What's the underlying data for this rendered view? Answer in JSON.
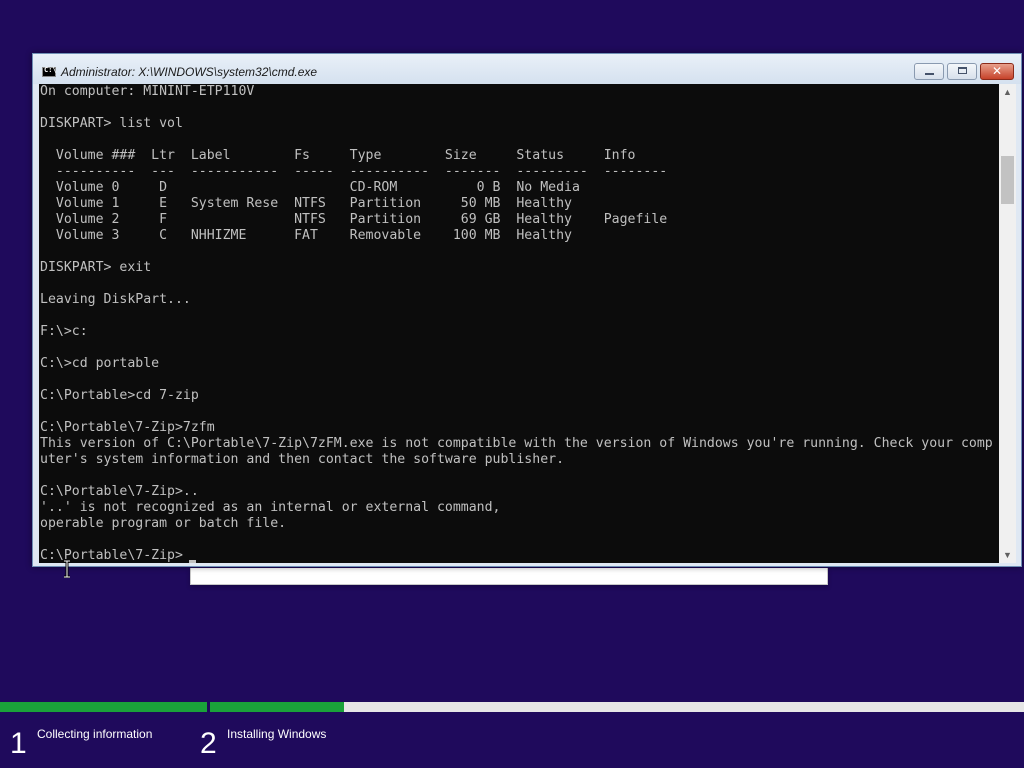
{
  "window": {
    "title": "Administrator: X:\\WINDOWS\\system32\\cmd.exe",
    "icon_text": "C:\\",
    "close_glyph": "✕"
  },
  "console": {
    "lines": [
      "On computer: MININT-ETP110V",
      "",
      "DISKPART> list vol",
      "",
      "  Volume ###  Ltr  Label        Fs     Type        Size     Status     Info",
      "  ----------  ---  -----------  -----  ----------  -------  ---------  --------",
      "  Volume 0     D                       CD-ROM          0 B  No Media",
      "  Volume 1     E   System Rese  NTFS   Partition     50 MB  Healthy",
      "  Volume 2     F                NTFS   Partition     69 GB  Healthy    Pagefile",
      "  Volume 3     C   NHHIZME      FAT    Removable    100 MB  Healthy",
      "",
      "DISKPART> exit",
      "",
      "Leaving DiskPart...",
      "",
      "F:\\>c:",
      "",
      "C:\\>cd portable",
      "",
      "C:\\Portable>cd 7-zip",
      "",
      "C:\\Portable\\7-Zip>7zfm",
      "This version of C:\\Portable\\7-Zip\\7zFM.exe is not compatible with the version of Windows you're running. Check your comp",
      "uter's system information and then contact the software publisher.",
      "",
      "C:\\Portable\\7-Zip>..",
      "'..' is not recognized as an internal or external command,",
      "operable program or batch file.",
      "",
      "C:\\Portable\\7-Zip>"
    ]
  },
  "scrollbar": {
    "up_glyph": "▲",
    "down_glyph": "▼"
  },
  "setup": {
    "steps": [
      {
        "number": "1",
        "label": "Collecting information",
        "progress": 1.0
      },
      {
        "number": "2",
        "label": "Installing Windows",
        "progress": 0.165
      }
    ],
    "progress_color": "#1aa23a",
    "background_color": "#1f0a5c"
  }
}
